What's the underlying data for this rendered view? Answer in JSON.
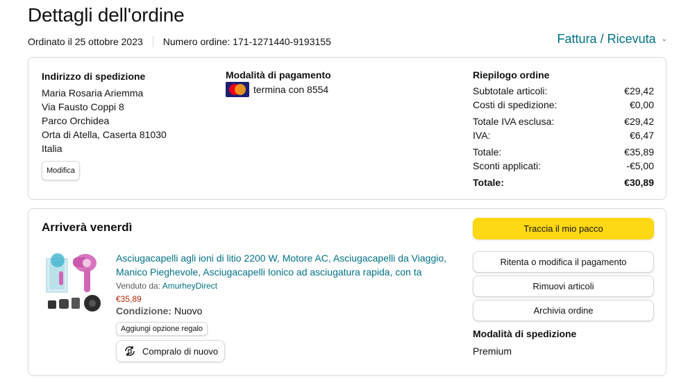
{
  "header": {
    "title": "Dettagli dell'ordine",
    "ordered_on": "Ordinato il 25 ottobre 2023",
    "order_number": "Numero ordine: 171-1271440-9193155",
    "invoice_link": "Fattura / Ricevuta"
  },
  "shipping_address": {
    "heading": "Indirizzo di spedizione",
    "lines": [
      "Maria Rosaria Ariemma",
      "Via Fausto Coppi 8",
      "Parco Orchidea",
      "Orta di Atella, Caserta 81030",
      "Italia"
    ],
    "edit_button": "Modifica"
  },
  "payment": {
    "heading": "Modalità di pagamento",
    "card_text": "termina con 8554",
    "card_icon": "mastercard-icon"
  },
  "summary": {
    "heading": "Riepilogo ordine",
    "rows": [
      {
        "label": "Subtotale articoli:",
        "value": "€29,42"
      },
      {
        "label": "Costi di spedizione:",
        "value": "€0,00"
      },
      {
        "label": "Totale IVA esclusa:",
        "value": "€29,42"
      },
      {
        "label": "IVA:",
        "value": "€6,47"
      },
      {
        "label": "Totale:",
        "value": "€35,89"
      },
      {
        "label": "Sconti applicati:",
        "value": "-€5,00"
      }
    ],
    "grand_total": {
      "label": "Totale:",
      "value": "€30,89"
    }
  },
  "shipment": {
    "arrival": "Arriverà venerdì",
    "product": {
      "title": "Asciugacapelli agli ioni di litio 2200 W, Motore AC, Asciugacapelli da Viaggio, Manico Pieghevole, Asciugacapelli Ionico ad asciugatura rapida, con ta",
      "sold_by_label": "Venduto da:",
      "seller": "AmurheyDirect",
      "price": "€35,89",
      "condition_label": "Condizione:",
      "condition_value": "Nuovo",
      "gift_button": "Aggiungi opzione regalo",
      "buy_again_button": "Compralo di nuovo"
    },
    "actions": {
      "track": "Traccia il mio pacco",
      "retry_payment": "Ritenta o modifica il pagamento",
      "remove_items": "Rimuovi articoli",
      "archive": "Archivia ordine"
    },
    "shipping_mode": {
      "heading": "Modalità di spedizione",
      "value": "Premium"
    }
  },
  "colors": {
    "link": "#007185",
    "price": "#b12704",
    "primary_button": "#ffd814",
    "border": "#d5d9d9"
  }
}
